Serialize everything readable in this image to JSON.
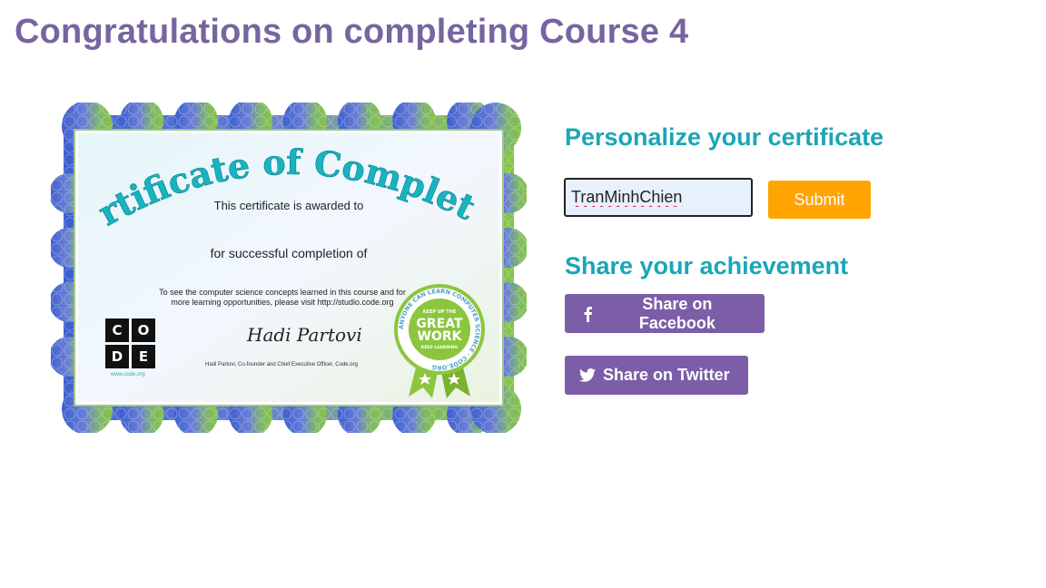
{
  "page": {
    "title": "Congratulations on completing Course 4"
  },
  "certificate": {
    "heading": "Certificate of Completion",
    "awarded_to": "This certificate is awarded to",
    "completion_of": "for successful completion of",
    "learn_more": "To see the computer science concepts learned in this course and for more learning opportunities, please visit http://studio.code.org",
    "logo_letters": [
      "C",
      "O",
      "D",
      "E"
    ],
    "logo_url": "www.code.org",
    "signature": "Hadi Partovi",
    "signature_caption": "Hadi Partovi, Co-founder and Chief Executive Officer, Code.org",
    "badge": {
      "ring_text": "ANYONE CAN LEARN COMPUTER SCIENCE · CODE.ORG",
      "top": "KEEP UP THE",
      "main_1": "GREAT",
      "main_2": "WORK",
      "bottom": "KEEP LEARNING"
    }
  },
  "personalize": {
    "heading": "Personalize your certificate",
    "name_value": "TranMinhChien",
    "submit_label": "Submit"
  },
  "share": {
    "heading": "Share your achievement",
    "facebook_label": "Share on Facebook",
    "twitter_label": "Share on Twitter"
  },
  "colors": {
    "title": "#7665a0",
    "heading": "#1aa6b7",
    "submit": "#ffa400",
    "share_button": "#7b5ea7",
    "badge": "#8cc63f"
  },
  "icons": {
    "facebook": "facebook-icon",
    "twitter": "twitter-icon"
  }
}
